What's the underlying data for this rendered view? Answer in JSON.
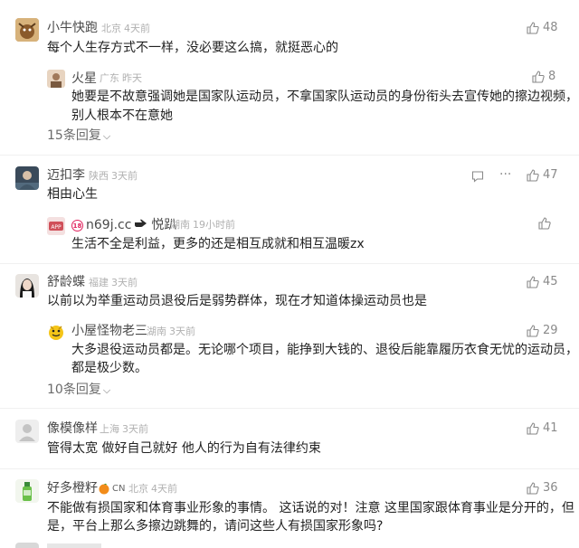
{
  "comments": [
    {
      "name": "小牛快跑",
      "location": "北京",
      "time": "4天前",
      "likes": "48",
      "text": "每个人生存方式不一样，没必要这么搞，就挺恶心的",
      "reply": {
        "name": "火星",
        "location": "广东",
        "time": "昨天",
        "likes": "8",
        "text_line1": "她要是不故意强调她是国家队运动员，不拿国家队运动员的身份衔头去宣传她的擦边视频，",
        "text_line2": "别人根本不在意她"
      },
      "more_replies": "15条回复"
    },
    {
      "name": "迈扣李",
      "location": "陕西",
      "time": "3天前",
      "likes": "47",
      "text": "相由心生",
      "reply": {
        "name": "n69j.cc",
        "name_suffix": "悦趴",
        "name_prefix_badge": "18",
        "location": "湖南",
        "time": "19小时前",
        "text_line1": "生活不全是利益，更多的还是相互成就和相互温暖zx"
      }
    },
    {
      "name": "舒龄蝶",
      "location": "福建",
      "time": "3天前",
      "likes": "45",
      "text": "以前以为举重运动员退役后是弱势群体，现在才知道体操运动员也是",
      "reply": {
        "name": "小屋怪物老三",
        "location": "湖南",
        "time": "3天前",
        "likes": "29",
        "text_line1": "大多退役运动员都是。无论哪个项目，能挣到大钱的、退役后能靠履历衣食无忧的运动员，",
        "text_line2": "都是极少数。"
      },
      "more_replies": "10条回复"
    },
    {
      "name": "像模像样",
      "location": "上海",
      "time": "3天前",
      "likes": "41",
      "text": "管得太宽 做好自己就好 他人的行为自有法律约束"
    },
    {
      "name": "好多橙籽",
      "badge": "CN",
      "location": "北京",
      "time": "4天前",
      "likes": "36",
      "text_line1": "不能做有损国家和体育事业形象的事情。 这话说的对！注意 这里国家跟体育事业是分开的，但",
      "text_line2": "是，平台上那么多擦边跳舞的，请问这些人有损国家形象吗?"
    }
  ],
  "colors": {
    "name": "#4a4a4a",
    "meta": "#b0b0b0",
    "text": "#222222",
    "like": "#8a8a8a",
    "badge_red": "#e0245e"
  }
}
